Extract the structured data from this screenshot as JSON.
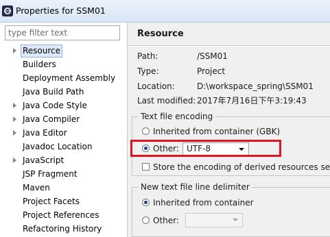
{
  "window": {
    "title": "Properties for SSM01",
    "app_icon": "eclipse-icon"
  },
  "filter": {
    "placeholder": "type filter text"
  },
  "tree": {
    "items": [
      {
        "label": "Resource",
        "expandable": true,
        "selected": true
      },
      {
        "label": "Builders",
        "expandable": false
      },
      {
        "label": "Deployment Assembly",
        "expandable": false
      },
      {
        "label": "Java Build Path",
        "expandable": false
      },
      {
        "label": "Java Code Style",
        "expandable": true
      },
      {
        "label": "Java Compiler",
        "expandable": true
      },
      {
        "label": "Java Editor",
        "expandable": true
      },
      {
        "label": "Javadoc Location",
        "expandable": false
      },
      {
        "label": "JavaScript",
        "expandable": true
      },
      {
        "label": "JSP Fragment",
        "expandable": false
      },
      {
        "label": "Maven",
        "expandable": false
      },
      {
        "label": "Project Facets",
        "expandable": false
      },
      {
        "label": "Project References",
        "expandable": false
      },
      {
        "label": "Refactoring History",
        "expandable": false
      }
    ]
  },
  "resource": {
    "heading": "Resource",
    "path_label": "Path:",
    "path_value": "/SSM01",
    "type_label": "Type:",
    "type_value": "Project",
    "location_label": "Location:",
    "location_value": "D:\\workspace_spring\\SSM01",
    "modified_label": "Last modified:",
    "modified_value": "2017年7月16日下午3:19:43"
  },
  "encoding": {
    "legend": "Text file encoding",
    "inherited_label": "Inherited from container (GBK)",
    "other_label": "Other:",
    "other_value": "UTF-8",
    "store_label": "Store the encoding of derived resources sep",
    "selected": "other"
  },
  "delimiter": {
    "legend": "New text file line delimiter",
    "inherited_label": "Inherited from container",
    "other_label": "Other:",
    "other_value": "",
    "selected": "inherited"
  },
  "colors": {
    "highlight": "#e0131f",
    "radio_dot": "#1f3f8f",
    "selection_bg": "#dde8f8"
  }
}
